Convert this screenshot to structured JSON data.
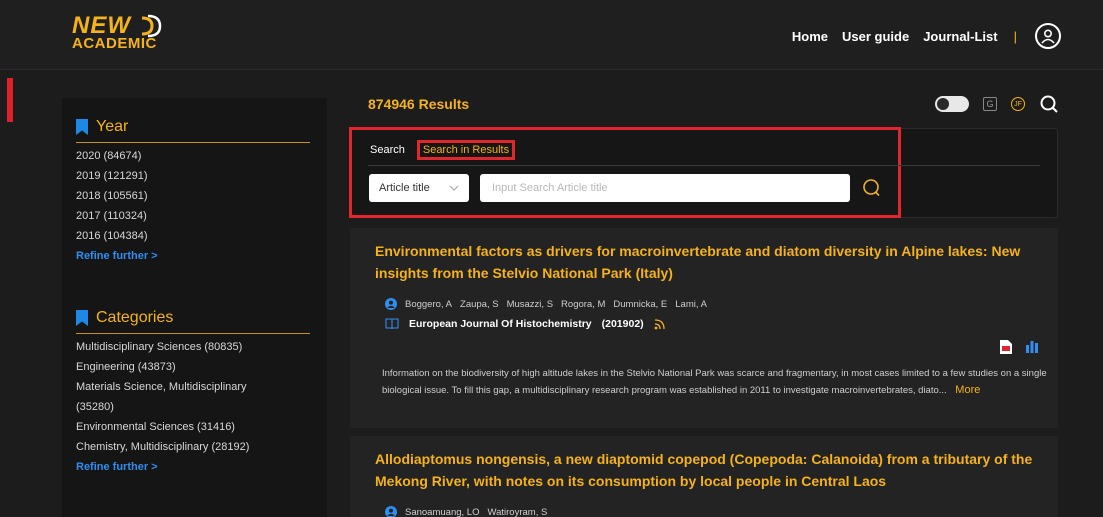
{
  "brand": {
    "line1": "NEW",
    "line2": "ACADEMIC"
  },
  "nav": {
    "home": "Home",
    "user_guide": "User guide",
    "journal_list": "Journal-List",
    "separator": "|"
  },
  "sidebar": {
    "year": {
      "heading": "Year",
      "items": [
        "2020 (84674)",
        "2019 (121291)",
        "2018 (105561)",
        "2017 (110324)",
        "2016 (104384)"
      ],
      "refine": "Refine further  >"
    },
    "categories": {
      "heading": "Categories",
      "items": [
        "Multidisciplinary Sciences (80835)",
        "Engineering (43873)",
        "Materials Science, Multidisciplinary",
        "(35280)",
        "Environmental Sciences (31416)",
        "Chemistry, Multidisciplinary (28192)"
      ],
      "refine": "Refine further  >"
    }
  },
  "main": {
    "results_count": "874946 Results",
    "search_tabs": [
      "Search",
      "Search in Results"
    ],
    "field_select": "Article title",
    "search_placeholder": "Input Search Article title",
    "results": [
      {
        "title": "Environmental factors as drivers for macroinvertebrate and diatom diversity in Alpine lakes: New insights from the Stelvio National Park (Italy)",
        "authors": [
          "Boggero, A",
          "Zaupa, S",
          "Musazzi, S",
          "Rogora, M",
          "Dumnicka, E",
          "Lami, A"
        ],
        "journal": "European Journal Of Histochemistry",
        "year": "(201902)",
        "abstract": "Information on the biodiversity of high altitude lakes in the Stelvio National Park was scarce and fragmentary, in most cases limited to a few studies on a single biological issue. To fill this gap, a multidisciplinary research program was established in 2011 to investigate macroinvertebrates, diato...",
        "more": "More"
      },
      {
        "title": "Allodiaptomus nongensis, a new diaptomid copepod (Copepoda: Calanoida) from a tributary of the Mekong River, with notes on its consumption by local people in Central Laos",
        "authors": [
          "Sanoamuang, LO",
          "Watiroyram, S"
        ]
      }
    ]
  },
  "colors": {
    "accent": "#f5b21a",
    "link": "#2f8ef0",
    "highlight": "#e2262e",
    "bookmark": "#1e88e5"
  }
}
